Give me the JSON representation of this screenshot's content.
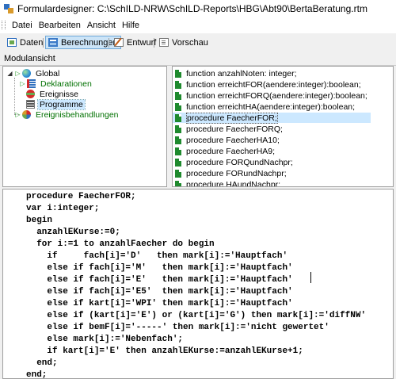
{
  "window": {
    "title": "Formulardesigner: C:\\SchILD-NRW\\SchILD-Reports\\HBG\\Abt90\\BertaBeratung.rtm"
  },
  "menu": {
    "items": [
      "Datei",
      "Bearbeiten",
      "Ansicht",
      "Hilfe"
    ]
  },
  "tabs": [
    {
      "label": "Daten",
      "icon": "data-icon"
    },
    {
      "label": "Berechnungen",
      "icon": "calculations-icon",
      "active": true
    },
    {
      "label": "Entwurf",
      "icon": "draft-icon"
    },
    {
      "label": "Vorschau",
      "icon": "preview-icon"
    }
  ],
  "modules": {
    "header": "Modulansicht",
    "tree": {
      "global": "Global",
      "declarations": "Deklarationen",
      "events": "Ereignisse",
      "programs": "Programme",
      "event_handlers": "Ereignisbehandlungen"
    },
    "list": [
      "function anzahlNoten: integer;",
      "function erreichtFOR(aendere:integer):boolean;",
      "function erreichtFORQ(aendere:integer):boolean;",
      "function erreichtHA(aendere:integer):boolean;",
      "procedure FaecherFOR;",
      "procedure FaecherFORQ;",
      "procedure FaecherHA10;",
      "procedure FaecherHA9;",
      "procedure FORQundNachpr;",
      "procedure FORundNachpr;",
      "procedure HAundNachpr;"
    ],
    "selected_index": 4
  },
  "editor": {
    "lines": [
      "procedure FaecherFOR;",
      "var i:integer;",
      "begin",
      "  anzahlEKurse:=0;",
      "  for i:=1 to anzahlFaecher do begin",
      "    if     fach[i]='D'   then mark[i]:='Hauptfach'",
      "    else if fach[i]='M'   then mark[i]:='Hauptfach'",
      "    else if fach[i]='E'   then mark[i]:='Hauptfach'",
      "    else if fach[i]='E5'  then mark[i]:='Hauptfach'",
      "    else if kart[i]='WPI' then mark[i]:='Hauptfach'",
      "    else if (kart[i]='E') or (kart[i]='G') then mark[i]:='diffNW'",
      "    else if bemF[i]='-----' then mark[i]:='nicht gewertet'",
      "    else mark[i]:='Nebenfach';",
      "    if kart[i]='E' then anzahlEKurse:=anzahlEKurse+1;",
      "  end;",
      "end;"
    ]
  },
  "colors": {
    "selection": "#cce8ff",
    "tree_green": "#007000",
    "code_blue": "#000080"
  }
}
